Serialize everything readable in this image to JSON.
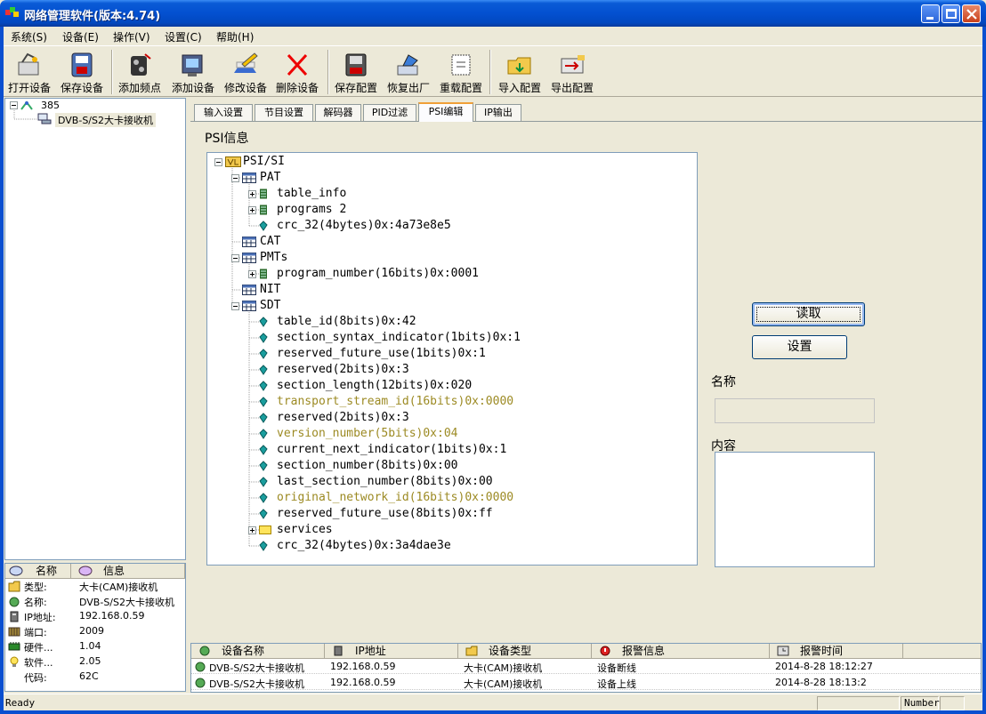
{
  "window": {
    "title": "网络管理软件(版本:4.74)"
  },
  "menu": [
    {
      "label": "系统(S)"
    },
    {
      "label": "设备(E)"
    },
    {
      "label": "操作(V)"
    },
    {
      "label": "设置(C)"
    },
    {
      "label": "帮助(H)"
    }
  ],
  "toolbar": [
    {
      "label": "打开设备",
      "icon": "open-device-icon"
    },
    {
      "label": "保存设备",
      "icon": "save-device-icon"
    },
    {
      "label": "添加频点",
      "icon": "add-frequency-icon"
    },
    {
      "label": "添加设备",
      "icon": "add-device-icon"
    },
    {
      "label": "修改设备",
      "icon": "edit-device-icon"
    },
    {
      "label": "删除设备",
      "icon": "delete-device-icon"
    },
    {
      "label": "保存配置",
      "icon": "save-config-icon"
    },
    {
      "label": "恢复出厂",
      "icon": "factory-reset-icon"
    },
    {
      "label": "重载配置",
      "icon": "reload-config-icon"
    },
    {
      "label": "导入配置",
      "icon": "import-config-icon"
    },
    {
      "label": "导出配置",
      "icon": "export-config-icon"
    }
  ],
  "device_tree": {
    "root": "385",
    "child": "DVB-S/S2大卡接收机"
  },
  "info_panel": {
    "headers": [
      "名称",
      "信息"
    ],
    "rows": [
      {
        "key": "类型:",
        "value": "大卡(CAM)接收机",
        "icon": "folder-icon"
      },
      {
        "key": "名称:",
        "value": "DVB-S/S2大卡接收机",
        "icon": "device-name-icon"
      },
      {
        "key": "IP地址:",
        "value": "192.168.0.59",
        "icon": "network-icon"
      },
      {
        "key": "端口:",
        "value": "2009",
        "icon": "port-icon"
      },
      {
        "key": "硬件...",
        "value": "1.04",
        "icon": "hardware-icon"
      },
      {
        "key": "软件...",
        "value": "2.05",
        "icon": "lightbulb-icon"
      },
      {
        "key": "代码:",
        "value": "62C",
        "icon": ""
      }
    ]
  },
  "tabs": [
    {
      "label": "输入设置"
    },
    {
      "label": "节目设置"
    },
    {
      "label": "解码器"
    },
    {
      "label": "PID过滤"
    },
    {
      "label": "PSI编辑",
      "active": true
    },
    {
      "label": "IP输出"
    }
  ],
  "psi": {
    "group_title": "PSI信息",
    "root": "PSI/SI",
    "pat": "PAT",
    "pat_children": [
      "table_info",
      "programs 2",
      "crc_32(4bytes)0x:4a73e8e5"
    ],
    "cat": "CAT",
    "pmts": "PMTs",
    "pmt_child": "program_number(16bits)0x:0001",
    "nit": "NIT",
    "sdt": "SDT",
    "sdt_children": [
      "table_id(8bits)0x:42",
      "section_syntax_indicator(1bits)0x:1",
      "reserved_future_use(1bits)0x:1",
      "reserved(2bits)0x:3",
      "section_length(12bits)0x:020",
      "transport_stream_id(16bits)0x:0000",
      "reserved(2bits)0x:3",
      "version_number(5bits)0x:04",
      "current_next_indicator(1bits)0x:1",
      "section_number(8bits)0x:00",
      "last_section_number(8bits)0x:00",
      "original_network_id(16bits)0x:0000",
      "reserved_future_use(8bits)0x:ff",
      "services",
      "crc_32(4bytes)0x:3a4dae3e"
    ],
    "highlight_color": "#9c8a23"
  },
  "editor": {
    "read_button": "读取",
    "set_button": "设置",
    "name_label": "名称",
    "name_value": "",
    "content_label": "内容",
    "content_value": ""
  },
  "log": {
    "headers": [
      "设备名称",
      "IP地址",
      "设备类型",
      "报警信息",
      "报警时间"
    ],
    "rows": [
      [
        "DVB-S/S2大卡接收机",
        "192.168.0.59",
        "大卡(CAM)接收机",
        "设备断线",
        "2014-8-28 18:12:27"
      ],
      [
        "DVB-S/S2大卡接收机",
        "192.168.0.59",
        "大卡(CAM)接收机",
        "设备上线",
        "2014-8-28 18:13:2"
      ]
    ]
  },
  "status": {
    "text": "Ready",
    "num_indicator": "Number"
  },
  "colors": {
    "title_blue": "#0350d0",
    "tab_active_top": "#f0a038",
    "panel": "#ece9d8"
  }
}
